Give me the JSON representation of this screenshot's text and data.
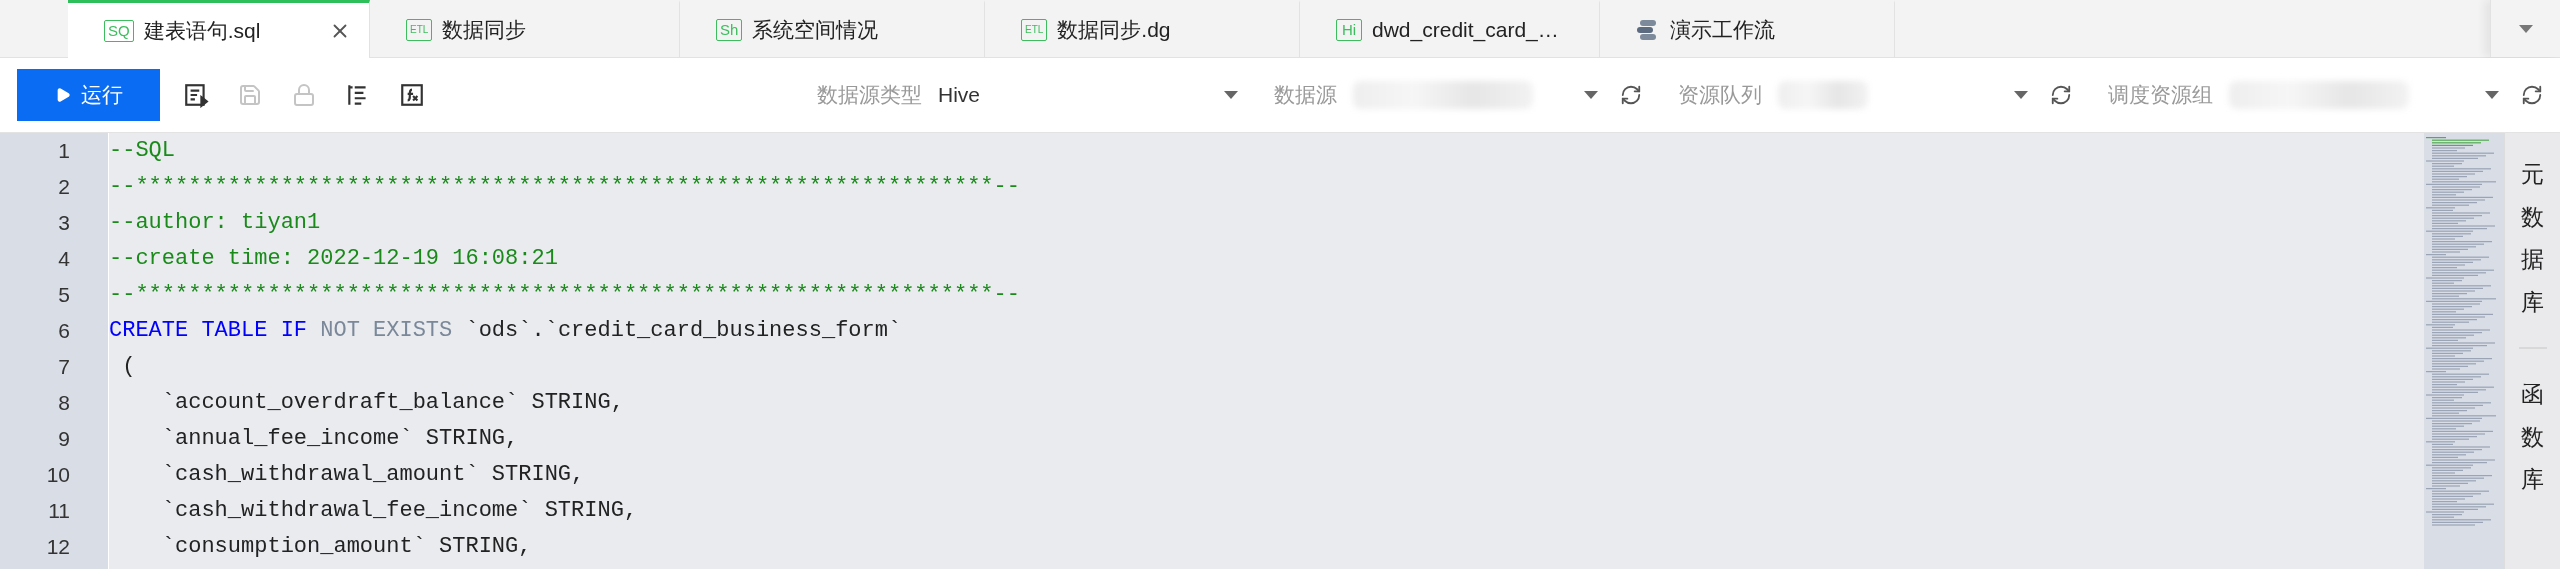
{
  "tabs": [
    {
      "badge": "SQ",
      "kind": "file",
      "label": "建表语句.sql",
      "selected": true,
      "closable": true
    },
    {
      "badge": "ETL",
      "kind": "file",
      "label": "数据同步",
      "selected": false,
      "closable": false
    },
    {
      "badge": "Sh",
      "kind": "file",
      "label": "系统空间情况",
      "selected": false,
      "closable": false
    },
    {
      "badge": "ETL",
      "kind": "file",
      "label": "数据同步.dg",
      "selected": false,
      "closable": false
    },
    {
      "badge": "Hi",
      "kind": "file",
      "label": "dwd_credit_card_…",
      "selected": false,
      "closable": false
    },
    {
      "kind": "workflow",
      "label": "演示工作流",
      "selected": false,
      "closable": false
    }
  ],
  "toolbar": {
    "run_button": "运行",
    "tools": [
      {
        "kind": "format",
        "disabled": false
      },
      {
        "kind": "save",
        "disabled": true
      },
      {
        "kind": "lock",
        "disabled": true
      },
      {
        "kind": "outline",
        "disabled": false
      },
      {
        "kind": "function",
        "disabled": false
      }
    ],
    "selects": [
      {
        "label": "数据源类型",
        "value": "Hive",
        "masked": false,
        "refresh": false
      },
      {
        "label": "数据源",
        "masked": true,
        "refresh": true
      },
      {
        "label": "资源队列",
        "masked": true,
        "refresh": true
      },
      {
        "label": "调度资源组",
        "masked": true,
        "refresh": true
      }
    ]
  },
  "editor": {
    "lines": [
      {
        "number": "1",
        "tokens": [
          {
            "kind": "comment",
            "text": "--SQL"
          }
        ]
      },
      {
        "number": "2",
        "tokens": [
          {
            "kind": "comment",
            "text": "--*****************************************************************--"
          }
        ]
      },
      {
        "number": "3",
        "tokens": [
          {
            "kind": "comment",
            "text": "--author: tiyan1"
          }
        ]
      },
      {
        "number": "4",
        "tokens": [
          {
            "kind": "comment",
            "text": "--create time: 2022-12-19 16:08:21"
          }
        ]
      },
      {
        "number": "5",
        "tokens": [
          {
            "kind": "comment",
            "text": "--*****************************************************************--"
          }
        ]
      },
      {
        "number": "6",
        "tokens": [
          {
            "kind": "keyword",
            "text": "CREATE TABLE IF "
          },
          {
            "kind": "operator",
            "text": "NOT EXISTS "
          },
          {
            "kind": "plain",
            "text": "`ods`.`credit_card_business_form`"
          }
        ]
      },
      {
        "number": "7",
        "tokens": [
          {
            "kind": "plain",
            "text": " ("
          }
        ]
      },
      {
        "number": "8",
        "tokens": [
          {
            "kind": "plain",
            "text": "    `account_overdraft_balance` STRING,"
          }
        ]
      },
      {
        "number": "9",
        "tokens": [
          {
            "kind": "plain",
            "text": "    `annual_fee_income` STRING,"
          }
        ]
      },
      {
        "number": "10",
        "tokens": [
          {
            "kind": "plain",
            "text": "    `cash_withdrawal_amount` STRING,"
          }
        ]
      },
      {
        "number": "11",
        "tokens": [
          {
            "kind": "plain",
            "text": "    `cash_withdrawal_fee_income` STRING,"
          }
        ]
      },
      {
        "number": "12",
        "tokens": [
          {
            "kind": "plain",
            "text": "    `consumption_amount` STRING,"
          }
        ]
      }
    ]
  },
  "side_panel": [
    {
      "label": "元数据库"
    },
    {
      "label": "函数库"
    }
  ]
}
